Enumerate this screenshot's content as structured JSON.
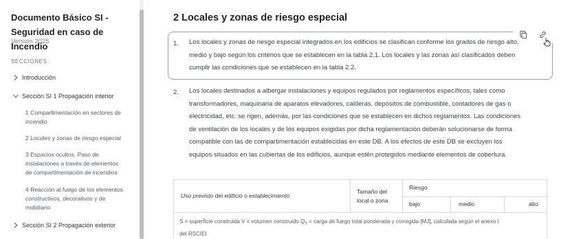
{
  "sidebar": {
    "title_line1": "Documento Básico SI -",
    "title_line2": "Seguridad en caso de Incendio",
    "version": "Versión 2025",
    "sections_heading": "SECCIONES",
    "items": [
      {
        "label": "Introducción",
        "expanded": false
      },
      {
        "label": "Sección SI 1 Propagación interior",
        "expanded": true
      },
      {
        "label": "Sección SI 2 Propagación exterior",
        "expanded": false
      }
    ],
    "subitems": [
      {
        "line1": "1 Compartimentación en sectores de",
        "line2": "incendio",
        "line3": "",
        "line4": ""
      },
      {
        "line1": "2 Locales y zonas de riesgo especial",
        "line2": "",
        "line3": "",
        "line4": ""
      },
      {
        "line1": "3 Espacios ocultos. Paso de",
        "line2": "instalaciones a través de elementos",
        "line3": "de compartimentación de incendios",
        "line4": ""
      },
      {
        "line1": "4 Reacción al fuego de los elementos",
        "line2": "constructivos, decorativos y de",
        "line3": "mobiliario",
        "line4": ""
      }
    ]
  },
  "main": {
    "title": "2 Locales y zonas de riesgo especial",
    "paragraphs": [
      {
        "num": "1.",
        "lines": [
          "Los locales y zonas de riesgo especial integrados en los edificios se clasifican conforme los grados de riesgo alto,",
          "medio y bajo según los criterios que se establecen en la tabla 2.1. Los locales y las zonas así clasificados deben",
          "cumplir las condiciones que se establecen en la tabla 2.2."
        ]
      },
      {
        "num": "2.",
        "lines": [
          "Los locales destinados a albergar instalaciones y equipos regulados por reglamentos específicos, tales como",
          "transformadores, maquinaria de aparatos elevadores, calderas, depósitos de combustible, contadores de gas o",
          "electricidad, etc. se rigen, además, por las condiciones que se establecen en dichos reglamentos. Las condiciones",
          "de ventilación de los locales y de los equipos exigidas por dicha reglamentación deberán solucionarse de forma",
          "compatible con las de compartimentación establecidas en este DB. A los efectos de este DB se excluyen los",
          "equipos situados en las cubiertas de los edificios, aunque estén protegidos mediante elementos de cobertura."
        ]
      }
    ],
    "tools": {
      "copy_icon": "copy-icon",
      "link_icon": "link-icon"
    },
    "table": {
      "col1_part1": "Uso previsto",
      "col1_part2": " del edificio o ",
      "col1_part3": "establecimiento",
      "col2_line1": "Tamaño del",
      "col2_line2": "local o zona",
      "riesgo": "Riesgo",
      "bajo": "bajo",
      "medio": "medio",
      "alto": "alto",
      "footnote_line1": "S = superficie construida V = volumen construido Q",
      "footnote_sub": "T",
      "footnote_line1b": " = carga de fuego total ponderada y corregida [MJ], calculada según el anexo I",
      "footnote_line2": "del RSCIEI"
    }
  }
}
